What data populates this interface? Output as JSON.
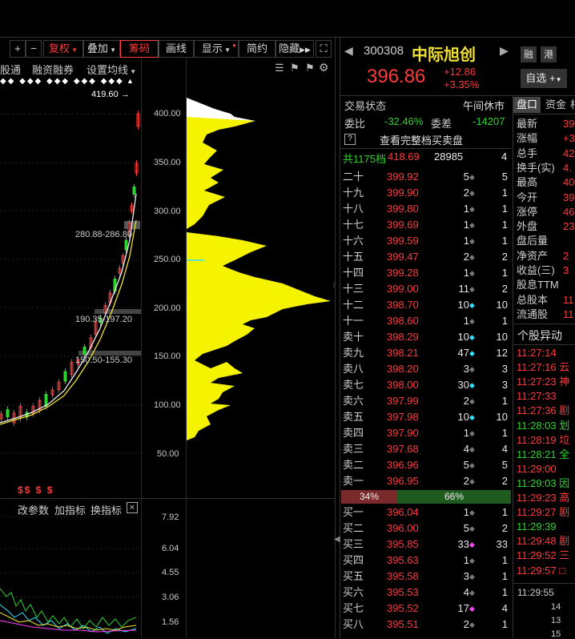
{
  "toolbar": {
    "plus": "+",
    "minus": "−",
    "fuquan": "复权",
    "diejia": "叠加",
    "chouma": "筹码",
    "huaxian": "画线",
    "xianshi": "显示",
    "jianyue": "简约",
    "yincang": "隐藏",
    "expand": "⛶"
  },
  "subbar": {
    "a": "股通",
    "b": "融资融券",
    "c": "设置均线"
  },
  "stock": {
    "code": "300308",
    "name": "中际旭创",
    "price": "396.86",
    "change": "+12.86",
    "pct": "+3.35%",
    "rong": "融",
    "gang": "港",
    "zixuan": "自选 +"
  },
  "status": {
    "label": "交易状态",
    "value": "午间休市"
  },
  "weibi": {
    "label": "委比",
    "value": "-32.46%",
    "cha_label": "委差",
    "cha_value": "-14207"
  },
  "buysell": {
    "q": "?",
    "label": "查看完整档买卖盘"
  },
  "total": {
    "label": "共1175档",
    "price": "418.69",
    "vol": "28985",
    "q": "4"
  },
  "sell_rows": [
    {
      "l": "二十",
      "p": "399.92",
      "v": "5",
      "d": "◆",
      "dc": "#777",
      "q": "5"
    },
    {
      "l": "十九",
      "p": "399.90",
      "v": "2",
      "d": "◆",
      "dc": "#777",
      "q": "1"
    },
    {
      "l": "十八",
      "p": "399.80",
      "v": "1",
      "d": "◆",
      "dc": "#777",
      "q": "1"
    },
    {
      "l": "十七",
      "p": "399.69",
      "v": "1",
      "d": "◆",
      "dc": "#777",
      "q": "1"
    },
    {
      "l": "十六",
      "p": "399.59",
      "v": "1",
      "d": "◆",
      "dc": "#777",
      "q": "1"
    },
    {
      "l": "十五",
      "p": "399.47",
      "v": "2",
      "d": "◆",
      "dc": "#777",
      "q": "2"
    },
    {
      "l": "十四",
      "p": "399.28",
      "v": "1",
      "d": "◆",
      "dc": "#777",
      "q": "1"
    },
    {
      "l": "十三",
      "p": "399.00",
      "v": "11",
      "d": "◆",
      "dc": "#777",
      "q": "2"
    },
    {
      "l": "十二",
      "p": "398.70",
      "v": "10",
      "d": "◆",
      "dc": "#2ee0ff",
      "q": "10"
    },
    {
      "l": "十一",
      "p": "398.60",
      "v": "1",
      "d": "◆",
      "dc": "#777",
      "q": "1"
    },
    {
      "l": "卖十",
      "p": "398.29",
      "v": "10",
      "d": "◆",
      "dc": "#2ee0ff",
      "q": "10"
    },
    {
      "l": "卖九",
      "p": "398.21",
      "v": "47",
      "d": "◆",
      "dc": "#2ee0ff",
      "q": "12"
    },
    {
      "l": "卖八",
      "p": "398.20",
      "v": "3",
      "d": "◆",
      "dc": "#777",
      "q": "3"
    },
    {
      "l": "卖七",
      "p": "398.00",
      "v": "30",
      "d": "◆",
      "dc": "#2ee0ff",
      "q": "3"
    },
    {
      "l": "卖六",
      "p": "397.99",
      "v": "2",
      "d": "◆",
      "dc": "#777",
      "q": "1"
    },
    {
      "l": "卖五",
      "p": "397.98",
      "v": "10",
      "d": "◆",
      "dc": "#2ee0ff",
      "q": "10"
    },
    {
      "l": "卖四",
      "p": "397.90",
      "v": "1",
      "d": "◆",
      "dc": "#777",
      "q": "1"
    },
    {
      "l": "卖三",
      "p": "397.68",
      "v": "4",
      "d": "◆",
      "dc": "#777",
      "q": "4"
    },
    {
      "l": "卖二",
      "p": "396.96",
      "v": "5",
      "d": "◆",
      "dc": "#777",
      "q": "5"
    },
    {
      "l": "卖一",
      "p": "396.95",
      "v": "2",
      "d": "◆",
      "dc": "#777",
      "q": "2"
    }
  ],
  "ratio": {
    "sell": "34%",
    "buy": "66%"
  },
  "buy_rows": [
    {
      "l": "买一",
      "p": "396.04",
      "v": "1",
      "d": "◆",
      "dc": "#777",
      "q": "1"
    },
    {
      "l": "买二",
      "p": "396.00",
      "v": "5",
      "d": "◆",
      "dc": "#777",
      "q": "2"
    },
    {
      "l": "买三",
      "p": "395.85",
      "v": "33",
      "d": "◆",
      "dc": "#ff40ff",
      "q": "33"
    },
    {
      "l": "买四",
      "p": "395.63",
      "v": "1",
      "d": "◆",
      "dc": "#777",
      "q": "1"
    },
    {
      "l": "买五",
      "p": "395.58",
      "v": "3",
      "d": "◆",
      "dc": "#777",
      "q": "1"
    },
    {
      "l": "买六",
      "p": "395.53",
      "v": "4",
      "d": "◆",
      "dc": "#777",
      "q": "1"
    },
    {
      "l": "买七",
      "p": "395.52",
      "v": "17",
      "d": "◆",
      "dc": "#ff40ff",
      "q": "4"
    },
    {
      "l": "买八",
      "p": "395.51",
      "v": "2",
      "d": "◆",
      "dc": "#777",
      "q": "1"
    }
  ],
  "tabs": {
    "t1": "盘口",
    "t2": "资金",
    "t3": "相"
  },
  "quote": [
    {
      "k": "最新",
      "v": "39"
    },
    {
      "k": "涨幅",
      "v": "+3."
    },
    {
      "k": "总手",
      "v": "42.8"
    },
    {
      "k": "换手(实)",
      "v": "4."
    },
    {
      "k": "最高",
      "v": "40"
    },
    {
      "k": "今开",
      "v": "39"
    },
    {
      "k": "涨停",
      "v": "46"
    },
    {
      "k": "外盘",
      "v": "23."
    },
    {
      "k": "盘后量",
      "v": ""
    },
    {
      "k": "净资产",
      "v": "2"
    },
    {
      "k": "收益(三)",
      "v": "3"
    },
    {
      "k": "股息TTM",
      "v": ""
    },
    {
      "k": "总股本",
      "v": "11."
    },
    {
      "k": "流通股",
      "v": "11.0"
    }
  ],
  "yidong": {
    "title": "个股异动",
    "items": [
      {
        "t": "11:27:14",
        "c": "#ff3b3b",
        "x": ""
      },
      {
        "t": "11:27:16",
        "c": "#ff3b3b",
        "x": "云"
      },
      {
        "t": "11:27:23",
        "c": "#ff3b3b",
        "x": "神"
      },
      {
        "t": "11:27:33",
        "c": "#ff3b3b",
        "x": ""
      },
      {
        "t": "11:27:36",
        "c": "#ff3b3b",
        "x": "剧"
      },
      {
        "t": "11:28:03",
        "c": "#2fd32f",
        "x": "划"
      },
      {
        "t": "11:28:19",
        "c": "#ff3b3b",
        "x": "垃"
      },
      {
        "t": "11:28:21",
        "c": "#2fd32f",
        "x": "全"
      },
      {
        "t": "11:29:00",
        "c": "#ff3b3b",
        "x": ""
      },
      {
        "t": "11:29:03",
        "c": "#2fd32f",
        "x": "因"
      },
      {
        "t": "11:29:23",
        "c": "#ff3b3b",
        "x": "高"
      },
      {
        "t": "11:29:27",
        "c": "#ff3b3b",
        "x": "剧"
      },
      {
        "t": "11:29:39",
        "c": "#2fd32f",
        "x": ""
      },
      {
        "t": "11:29:48",
        "c": "#ff3b3b",
        "x": "剧"
      },
      {
        "t": "11:29:52",
        "c": "#ff3b3b",
        "x": "三"
      },
      {
        "t": "11:29:57",
        "c": "#ff3b3b",
        "x": "□"
      }
    ]
  },
  "ticks": {
    "time": "11:29:55",
    "a": "14",
    "b": "13",
    "c": "15"
  },
  "kline": {
    "max_label": "419.60",
    "mid1": "280.88-286.80",
    "mid2": "190.35-197.20",
    "mid3": "150.50-155.30",
    "marks": "$$ $ $"
  },
  "chip_axis": [
    "400.00",
    "350.00",
    "300.00",
    "250.00",
    "200.00",
    "150.00",
    "100.00",
    "50.00"
  ],
  "indicator": {
    "gaican": "改参数",
    "jia": "加指标",
    "huan": "换指标",
    "close": "×",
    "axis": [
      "7.92",
      "6.04",
      "4.55",
      "3.06",
      "1.56"
    ]
  }
}
